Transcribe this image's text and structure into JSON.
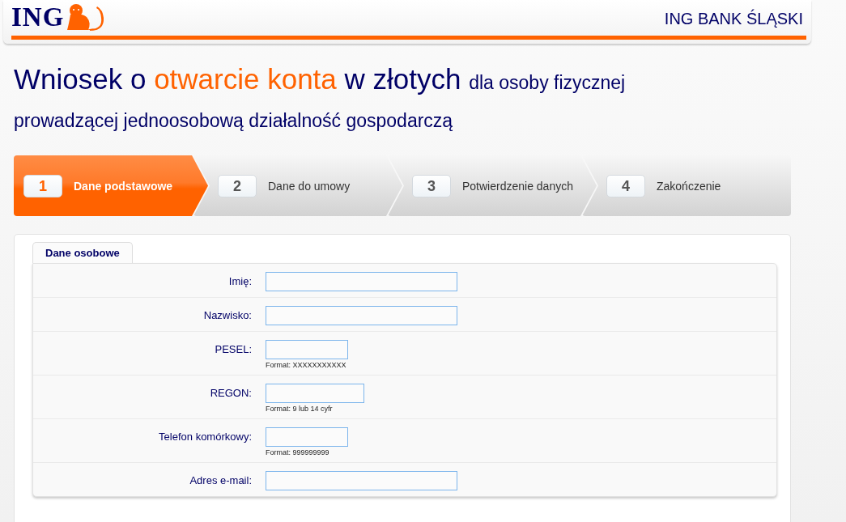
{
  "header": {
    "logo": "ING",
    "bank_name": "ING BANK ŚLĄSKI"
  },
  "title": [
    {
      "text": "Wniosek o ",
      "kind": "main"
    },
    {
      "text": "otwarcie konta",
      "kind": "accent"
    },
    {
      "text": " w złotych ",
      "kind": "main"
    },
    {
      "text": "dla osoby fizycznej prowadzącej jednoosobową działalność gospodarczą",
      "kind": "small"
    }
  ],
  "steps": [
    {
      "number": "1",
      "label": "Dane podstawowe",
      "selected": true
    },
    {
      "number": "2",
      "label": "Dane do umowy",
      "selected": false
    },
    {
      "number": "3",
      "label": "Potwierdzenie danych",
      "selected": false
    },
    {
      "number": "4",
      "label": "Zakończenie",
      "selected": false
    }
  ],
  "form": {
    "tabs": [
      {
        "label": "Dane osobowe",
        "selected": true
      }
    ],
    "fields": [
      {
        "label": "Imię:",
        "kind": "wide"
      },
      {
        "label": "Nazwisko:",
        "kind": "wide"
      },
      {
        "label": "PESEL:",
        "kind": "short",
        "hint": "Format: XXXXXXXXXXX"
      },
      {
        "label": "REGON:",
        "kind": "medium",
        "hint": "Format: 9 lub 14 cyfr"
      },
      {
        "label": "Telefon komórkowy:",
        "kind": "short",
        "hint": "Format: 999999999"
      },
      {
        "label": "Adres e-mail:",
        "kind": "wide"
      }
    ]
  }
}
